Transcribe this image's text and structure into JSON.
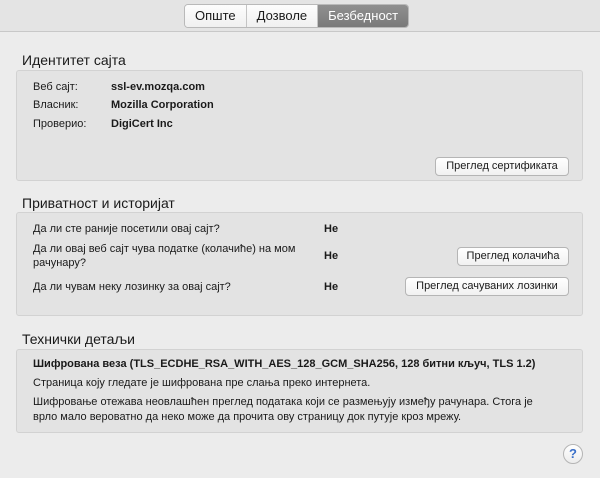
{
  "tabs": [
    {
      "label": "Опште",
      "selected": false
    },
    {
      "label": "Дозволе",
      "selected": false
    },
    {
      "label": "Безбедност",
      "selected": true
    }
  ],
  "identity": {
    "title": "Идентитет сајта",
    "website_label": "Веб сајт:",
    "website_value": "ssl-ev.mozqa.com",
    "owner_label": "Власник:",
    "owner_value": "Mozilla Corporation",
    "verifier_label": "Проверио:",
    "verifier_value": "DigiCert Inc",
    "view_certificate_button": "Преглед сертификата"
  },
  "privacy": {
    "title": "Приватност и историјат",
    "visited_question": "Да ли сте раније посетили овај сајт?",
    "visited_answer": "Не",
    "cookies_question_line1": "Да ли овај веб сајт чува податке (колачиће) на мом",
    "cookies_question_line2": "рачунару?",
    "cookies_answer": "Не",
    "view_cookies_button": "Преглед колачића",
    "passwords_question": "Да ли чувам неку лозинку за овај сајт?",
    "passwords_answer": "Не",
    "view_passwords_button": "Преглед сачуваних лозинки"
  },
  "technical": {
    "title": "Технички детаљи",
    "connection_heading": "Шифрована веза (TLS_ECDHE_RSA_WITH_AES_128_GCM_SHA256, 128 битни кључ, TLS 1.2)",
    "encrypted_note": "Страница коју гледате је шифрована пре слања преко интернета.",
    "explanation_line1": "Шифровање отежава неовлашћен преглед података који се размењују између рачунара. Стога је",
    "explanation_line2": "врло мало вероватно да неко може да прочита ову страницу док путује кроз мрежу."
  },
  "help_button_label": "?"
}
